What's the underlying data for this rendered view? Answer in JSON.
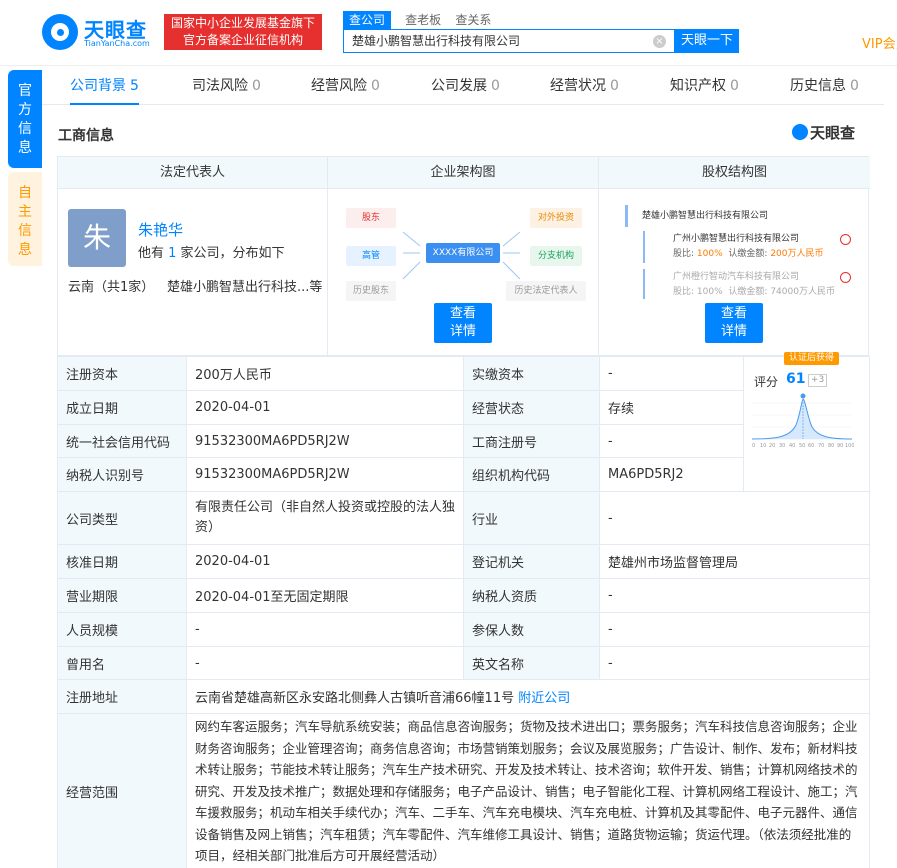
{
  "header": {
    "logo_text": "天眼查",
    "logo_sub": "TianYanCha.com",
    "banner_line1": "国家中小企业发展基金旗下",
    "banner_line2": "官方备案企业征信机构",
    "search_tabs": [
      "查公司",
      "查老板",
      "查关系"
    ],
    "search_value": "楚雄小鹏智慧出行科技有限公司",
    "search_button": "天眼一下",
    "vip": "VIP会员"
  },
  "side_tabs": {
    "official": "官方信息",
    "self": "自主信息"
  },
  "nav": [
    {
      "label": "公司背景",
      "count": "5"
    },
    {
      "label": "司法风险",
      "count": "0"
    },
    {
      "label": "经营风险",
      "count": "0"
    },
    {
      "label": "公司发展",
      "count": "0"
    },
    {
      "label": "经营状况",
      "count": "0"
    },
    {
      "label": "知识产权",
      "count": "0"
    },
    {
      "label": "历史信息",
      "count": "0"
    }
  ],
  "section": {
    "title": "工商信息",
    "logo": "天眼查"
  },
  "top": {
    "headers": [
      "法定代表人",
      "企业架构图",
      "股权结构图"
    ],
    "person": {
      "avatar": "朱",
      "name": "朱艳华",
      "desc_pre": "他有 ",
      "desc_num": "1",
      "desc_post": " 家公司，分布如下",
      "location": "云南（共1家）",
      "company": "楚雄小鹏智慧出行科技...等"
    },
    "arch": {
      "left": [
        "股东",
        "高管",
        "历史股东"
      ],
      "center": "XXXX有限公司",
      "right": [
        "对外投资",
        "分支机构",
        "历史法定代表人"
      ],
      "button": "查看详情"
    },
    "equity": {
      "root": "楚雄小鹏智慧出行科技有限公司",
      "holder1": "广州小鹏智慧出行科技有限公司",
      "ratio1_label": "股比:",
      "ratio1": "100%",
      "capital1_label": "认缴金额:",
      "capital1": "200万人民币",
      "holder2": "广州橙行智动汽车科技有限公司",
      "ratio2_label": "股比:",
      "ratio2": "100%",
      "capital2_label": "认缴金额:",
      "capital2": "74000万人民币",
      "button": "查看详情"
    }
  },
  "info": {
    "reg_capital_label": "注册资本",
    "reg_capital": "200万人民币",
    "paid_capital_label": "实缴资本",
    "paid_capital": "-",
    "found_date_label": "成立日期",
    "found_date": "2020-04-01",
    "status_label": "经营状态",
    "status": "存续",
    "credit_code_label": "统一社会信用代码",
    "credit_code": "91532300MA6PD5RJ2W",
    "reg_no_label": "工商注册号",
    "reg_no": "-",
    "tax_id_label": "纳税人识别号",
    "tax_id": "91532300MA6PD5RJ2W",
    "org_code_label": "组织机构代码",
    "org_code": "MA6PD5RJ2",
    "type_label": "公司类型",
    "type": "有限责任公司（非自然人投资或控股的法人独资）",
    "industry_label": "行业",
    "industry": "-",
    "approve_date_label": "核准日期",
    "approve_date": "2020-04-01",
    "authority_label": "登记机关",
    "authority": "楚雄州市场监督管理局",
    "term_label": "营业期限",
    "term": "2020-04-01至无固定期限",
    "taxpayer_label": "纳税人资质",
    "taxpayer": "-",
    "staff_label": "人员规模",
    "staff": "-",
    "insured_label": "参保人数",
    "insured": "-",
    "former_label": "曾用名",
    "former": "-",
    "english_label": "英文名称",
    "english": "-",
    "address_label": "注册地址",
    "address": "云南省楚雄高新区永安路北侧彝人古镇听音浦66幢11号",
    "address_link": "附近公司",
    "scope_label": "经营范围",
    "scope": "网约车客运服务；汽车导航系统安装；商品信息咨询服务；货物及技术进出口；票务服务；汽车科技信息咨询服务；企业财务咨询服务；企业管理咨询；商务信息咨询；市场营销策划服务；会议及展览服务；广告设计、制作、发布；新材料技术转让服务；节能技术转让服务；汽车生产技术研究、开发及技术转让、技术咨询；软件开发、销售；计算机网络技术的研究、开发及技术推广；数据处理和存储服务；电子产品设计、销售；电子智能化工程、计算机网络工程设计、施工；汽车援救服务；机动车相关手续代办；汽车、二手车、汽车充电模块、汽车充电桩、计算机及其零配件、电子元器件、通信设备销售及网上销售；汽车租赁；汽车零配件、汽车维修工具设计、销售；道路货物运输；货运代理。（依法须经批准的项目，经相关部门批准后方可开展经营活动）"
  },
  "score": {
    "badge": "认证后获得",
    "label": "评分",
    "value": "61",
    "plus": "+3",
    "axis": [
      "0",
      "10",
      "20",
      "30",
      "40",
      "50",
      "60",
      "70",
      "80",
      "90",
      "100"
    ]
  },
  "colors": {
    "brand": "#0084ff",
    "banner": "#e5302f",
    "vip": "#ff9900",
    "label_bg": "#f2f9fc"
  }
}
